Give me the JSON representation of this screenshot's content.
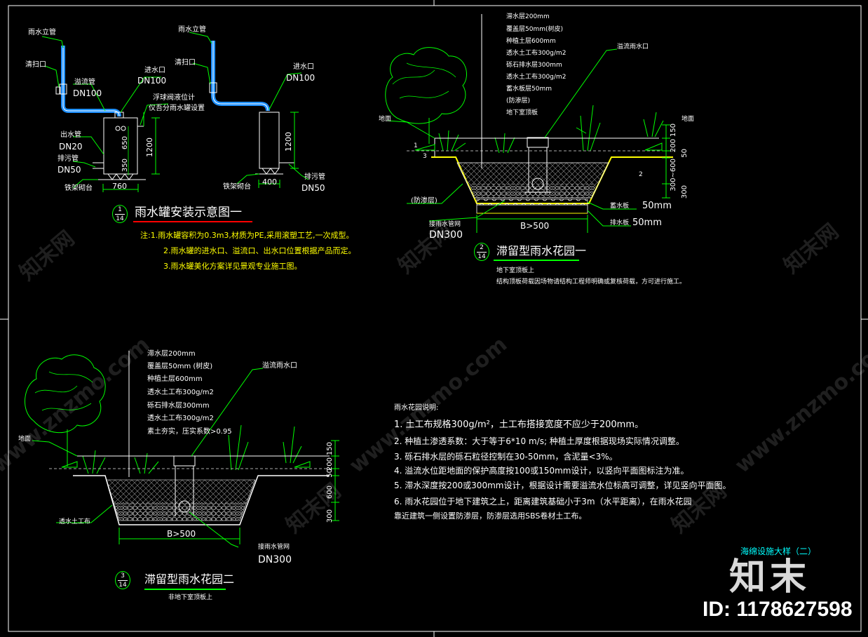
{
  "watermark": {
    "site": "www.znzmo.com",
    "brand": "知末网"
  },
  "logo": {
    "text": "知末",
    "id": "ID: 1178627598"
  },
  "sheet_title": "海绵设施大样（二）",
  "fig1": {
    "badge_num": "1",
    "badge_sheet": "14",
    "title": "雨水罐安装示意图一",
    "labels": {
      "standpipe_l": "雨水立管",
      "cleanout_l": "清扫口",
      "overflow": "溢流管",
      "overflow_dn": "DN100",
      "outlet": "出水管",
      "outlet_dn": "DN20",
      "drain": "排污管",
      "drain_dn": "DN50",
      "base_l": "铁架砌台",
      "standpipe_r": "雨水立管",
      "cleanout_r": "清扫口",
      "inlet_l": "进水口",
      "inlet_l_dn": "DN100",
      "inlet_r": "进水口",
      "inlet_r_dn": "DN100",
      "float_valve": "浮球阀液位计",
      "float_valve2": "仪吾分雨水罐设置",
      "drain_r": "排污管",
      "drain_r_dn": "DN50",
      "base_r": "铁架砌台"
    },
    "dims": {
      "d650": "650",
      "d350": "350",
      "d1200": "1200",
      "d760": "760",
      "d1200r": "1200",
      "d400": "400"
    },
    "notes": [
      "注:1.雨水罐容积为0.3m3,材质为PE,采用滚塑工艺,一次成型。",
      "2.雨水罐的进水口、溢流口、出水口位置根据产品而定。",
      "3.雨水罐美化方案详见景观专业施工图。"
    ]
  },
  "fig2": {
    "badge_num": "2",
    "badge_sheet": "14",
    "title": "滞留型雨水花园一",
    "subtitle1": "地下室顶板上",
    "subtitle2": "结构顶板荷载因场物请结构工程师明确或复核荷载，方可进行施工。",
    "layers": [
      "滞水层200mm",
      "覆盖层50mm(树皮)",
      "种植土层600mm",
      "透水土工布300g/m2",
      "砾石排水层300mm",
      "透水土工布300g/m2",
      "蓄水板层50mm",
      "(防渗层)",
      "地下室顶板"
    ],
    "overflow_inlet": "溢流雨水口",
    "ground": "地面",
    "ground_l": "地面",
    "waterproof": "(防渗层)",
    "pipe": "接雨水管网",
    "pipe_dn": "DN300",
    "storage": "蓄水板",
    "storage_v": "50mm",
    "drainage": "排水板",
    "drainage_v": "50mm",
    "width": "B>500",
    "dims": [
      "150",
      "200",
      "50",
      "300~600",
      "300"
    ],
    "slope_1": "1",
    "slope_3": "3",
    "slope_2": "2"
  },
  "fig3": {
    "badge_num": "3",
    "badge_sheet": "14",
    "title": "滞留型雨水花园二",
    "subtitle": "非地下室顶板上",
    "layers": [
      "滞水层200mm",
      "覆盖层50mm (树皮)",
      "种植土层600mm",
      "透水土工布300g/m2",
      "砾石排水层300mm",
      "透水土工布300g/m2",
      "素土夯实，压实系数>0.95"
    ],
    "overflow_inlet": "溢流雨水口",
    "ground": "地面",
    "geotextile": "透水土工布",
    "pipe": "接雨水管网",
    "pipe_dn": "DN300",
    "width": "B>500",
    "dims": [
      "150",
      "200",
      "50",
      "600",
      "300"
    ]
  },
  "notes_section": {
    "title": "雨水花园说明:",
    "items": [
      "1. 土工布规格300g/m²，土工布搭接宽度不应少于200mm。",
      "2. 种植土渗透系数：大于等于6*10  m/s; 种植土厚度根据现场实际情况调整。",
      "3. 砾石排水层的砾石粒径控制在30-50mm，含泥量<3%。",
      "4. 溢流水位距地面的保护高度按100或150mm设计，以竖向平面图标注为准。",
      "5. 滞水深度按200或300mm设计，根据设计需要溢流水位标高可调整，详见竖向平面图。",
      "6. 雨水花园位于地下建筑之上，距离建筑基础小于3m（水平距离），在雨水花园",
      "靠近建筑一侧设置防渗层，防渗层选用SBS卷材土工布。"
    ]
  }
}
